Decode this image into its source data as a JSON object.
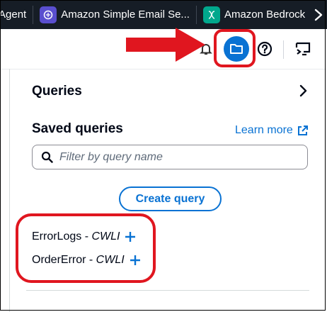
{
  "bookmarks": [
    {
      "label": "Agent",
      "icon": "none"
    },
    {
      "label": "Amazon Simple Email Se...",
      "icon": "ses-icon",
      "color": "#5a4fcf"
    },
    {
      "label": "Amazon Bedrock",
      "icon": "bedrock-icon",
      "color": "#01a88d"
    },
    {
      "label": "",
      "icon": "service-icon",
      "color": "#e07b00"
    }
  ],
  "panel": {
    "queries_title": "Queries",
    "saved_title": "Saved queries",
    "learn_more": "Learn more",
    "search_placeholder": "Filter by query name",
    "create_button": "Create query",
    "saved_queries": [
      {
        "name": "ErrorLogs",
        "type": "CWLI"
      },
      {
        "name": "OrderError",
        "type": "CWLI"
      }
    ]
  },
  "colors": {
    "accent": "#0972d3",
    "annotation": "#e0161f",
    "bookmark_bar": "#161d26"
  }
}
